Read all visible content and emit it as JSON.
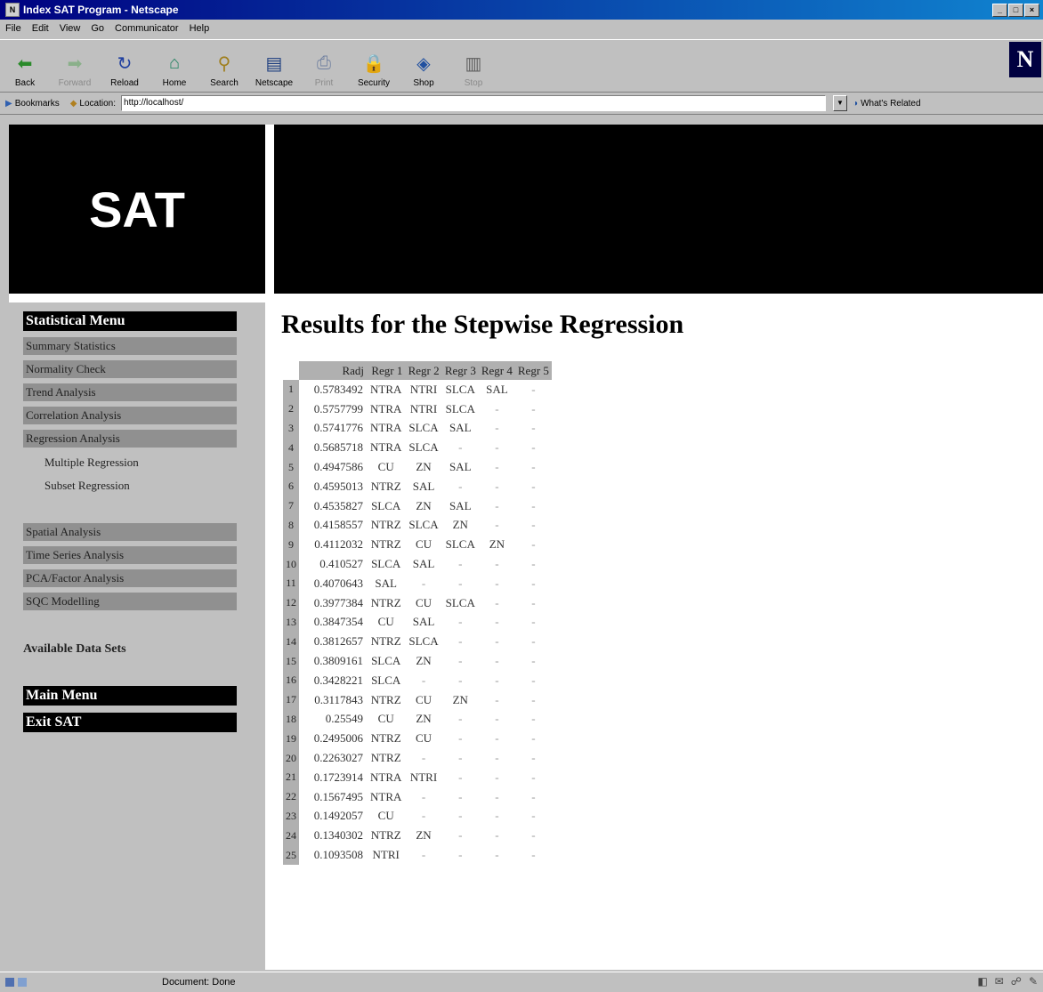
{
  "window": {
    "title": "Index SAT Program - Netscape",
    "controls": [
      "_",
      "□",
      "×"
    ]
  },
  "menubar": [
    "File",
    "Edit",
    "View",
    "Go",
    "Communicator",
    "Help"
  ],
  "toolbar": [
    {
      "label": "Back",
      "icon": "back-arrow-icon",
      "glyph": "⬅",
      "color": "#2a8a2a"
    },
    {
      "label": "Forward",
      "icon": "forward-arrow-icon",
      "glyph": "➡",
      "color": "#8ab08a"
    },
    {
      "label": "Reload",
      "icon": "reload-icon",
      "glyph": "↻",
      "color": "#2040a0"
    },
    {
      "label": "Home",
      "icon": "home-icon",
      "glyph": "⌂",
      "color": "#208060"
    },
    {
      "label": "Search",
      "icon": "search-icon",
      "glyph": "⚲",
      "color": "#a08020"
    },
    {
      "label": "Netscape",
      "icon": "netscape-icon",
      "glyph": "▤",
      "color": "#204080"
    },
    {
      "label": "Print",
      "icon": "print-icon",
      "glyph": "⎙",
      "color": "#7080a0"
    },
    {
      "label": "Security",
      "icon": "security-lock-icon",
      "glyph": "🔒",
      "color": "#b04040"
    },
    {
      "label": "Shop",
      "icon": "shop-icon",
      "glyph": "◈",
      "color": "#2050a0"
    },
    {
      "label": "Stop",
      "icon": "stop-icon",
      "glyph": "▥",
      "color": "#606060"
    }
  ],
  "location": {
    "bookmarks_label": "Bookmarks",
    "location_label": "Location:",
    "url": "http://localhost/",
    "whats_related": "What's Related"
  },
  "banner": {
    "title": "SAT"
  },
  "sidebar": {
    "header": "Statistical Menu",
    "items": [
      "Summary Statistics",
      "Normality Check",
      "Trend Analysis",
      "Correlation Analysis",
      "Regression Analysis"
    ],
    "subitems": [
      "Multiple Regression",
      "Subset Regression"
    ],
    "items2": [
      "Spatial Analysis",
      "Time Series Analysis",
      "PCA/Factor Analysis",
      "SQC Modelling"
    ],
    "available": "Available Data Sets",
    "main_menu": "Main Menu",
    "exit": "Exit SAT"
  },
  "main": {
    "heading": "Results for the Stepwise Regression",
    "columns": [
      "Radj",
      "Regr 1",
      "Regr 2",
      "Regr 3",
      "Regr 4",
      "Regr 5"
    ],
    "rows": [
      [
        "1",
        "0.5783492",
        "NTRA",
        "NTRI",
        "SLCA",
        "SAL",
        "-"
      ],
      [
        "2",
        "0.5757799",
        "NTRA",
        "NTRI",
        "SLCA",
        "-",
        "-"
      ],
      [
        "3",
        "0.5741776",
        "NTRA",
        "SLCA",
        "SAL",
        "-",
        "-"
      ],
      [
        "4",
        "0.5685718",
        "NTRA",
        "SLCA",
        "-",
        "-",
        "-"
      ],
      [
        "5",
        "0.4947586",
        "CU",
        "ZN",
        "SAL",
        "-",
        "-"
      ],
      [
        "6",
        "0.4595013",
        "NTRZ",
        "SAL",
        "-",
        "-",
        "-"
      ],
      [
        "7",
        "0.4535827",
        "SLCA",
        "ZN",
        "SAL",
        "-",
        "-"
      ],
      [
        "8",
        "0.4158557",
        "NTRZ",
        "SLCA",
        "ZN",
        "-",
        "-"
      ],
      [
        "9",
        "0.4112032",
        "NTRZ",
        "CU",
        "SLCA",
        "ZN",
        "-"
      ],
      [
        "10",
        "0.410527",
        "SLCA",
        "SAL",
        "-",
        "-",
        "-"
      ],
      [
        "11",
        "0.4070643",
        "SAL",
        "-",
        "-",
        "-",
        "-"
      ],
      [
        "12",
        "0.3977384",
        "NTRZ",
        "CU",
        "SLCA",
        "-",
        "-"
      ],
      [
        "13",
        "0.3847354",
        "CU",
        "SAL",
        "-",
        "-",
        "-"
      ],
      [
        "14",
        "0.3812657",
        "NTRZ",
        "SLCA",
        "-",
        "-",
        "-"
      ],
      [
        "15",
        "0.3809161",
        "SLCA",
        "ZN",
        "-",
        "-",
        "-"
      ],
      [
        "16",
        "0.3428221",
        "SLCA",
        "-",
        "-",
        "-",
        "-"
      ],
      [
        "17",
        "0.3117843",
        "NTRZ",
        "CU",
        "ZN",
        "-",
        "-"
      ],
      [
        "18",
        "0.25549",
        "CU",
        "ZN",
        "-",
        "-",
        "-"
      ],
      [
        "19",
        "0.2495006",
        "NTRZ",
        "CU",
        "-",
        "-",
        "-"
      ],
      [
        "20",
        "0.2263027",
        "NTRZ",
        "-",
        "-",
        "-",
        "-"
      ],
      [
        "21",
        "0.1723914",
        "NTRA",
        "NTRI",
        "-",
        "-",
        "-"
      ],
      [
        "22",
        "0.1567495",
        "NTRA",
        "-",
        "-",
        "-",
        "-"
      ],
      [
        "23",
        "0.1492057",
        "CU",
        "-",
        "-",
        "-",
        "-"
      ],
      [
        "24",
        "0.1340302",
        "NTRZ",
        "ZN",
        "-",
        "-",
        "-"
      ],
      [
        "25",
        "0.1093508",
        "NTRI",
        "-",
        "-",
        "-",
        "-"
      ]
    ]
  },
  "status": {
    "message": "Document: Done"
  }
}
